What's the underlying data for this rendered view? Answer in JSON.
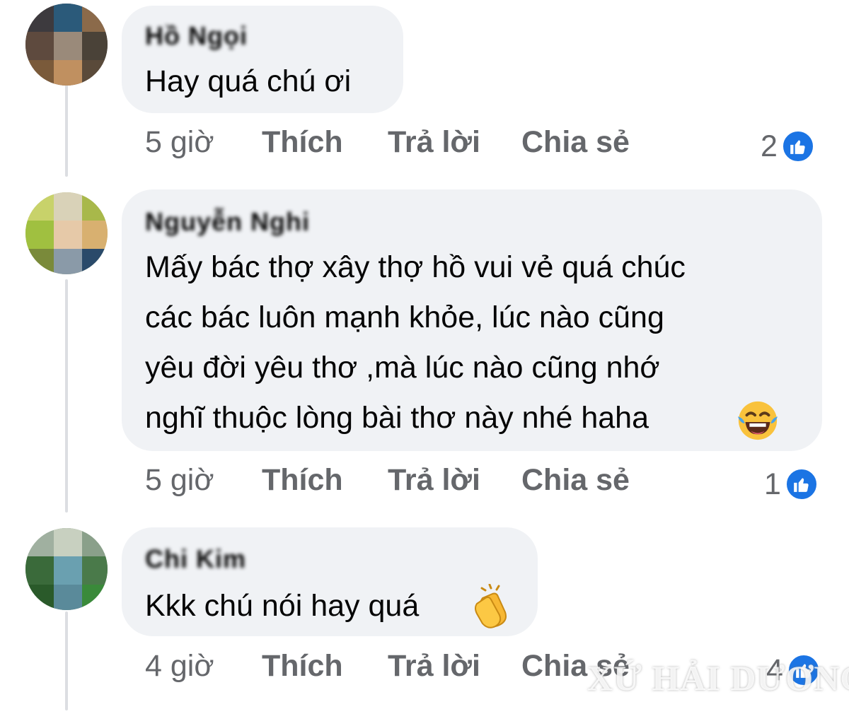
{
  "comments": [
    {
      "author": "Hồ Ngọi",
      "text_lines": [
        "Hay quá chú ơi"
      ],
      "time": "5 giờ",
      "like_label": "Thích",
      "reply_label": "Trả lời",
      "share_label": "Chia sẻ",
      "reaction_count": "2",
      "reaction_icon": "like-icon"
    },
    {
      "author": "Nguyễn Nghi",
      "text_lines": [
        "Mấy bác thợ xây thợ hồ vui vẻ quá chúc",
        "các bác luôn mạnh khỏe, lúc nào cũng",
        "yêu đời yêu thơ ,mà lúc nào cũng nhớ",
        "nghĩ thuộc lòng bài thơ này nhé haha"
      ],
      "emoji": "tears-of-joy-emoji",
      "time": "5 giờ",
      "like_label": "Thích",
      "reply_label": "Trả lời",
      "share_label": "Chia sẻ",
      "reaction_count": "1",
      "reaction_icon": "like-icon"
    },
    {
      "author": "Chi Kim",
      "text_lines": [
        "Kkk chú nói hay quá"
      ],
      "emoji": "clapping-hands-emoji",
      "time": "4 giờ",
      "like_label": "Thích",
      "reply_label": "Trả lời",
      "share_label": "Chia sẻ",
      "reaction_count": "4",
      "reaction_icon": "like-icon"
    }
  ],
  "watermark": "XỨ HẢI DƯƠNG",
  "colors": {
    "bubble": "#f0f2f5",
    "secondary_text": "#65676b",
    "like_blue": "#1b74e4",
    "thread_line": "#dcdee2"
  }
}
